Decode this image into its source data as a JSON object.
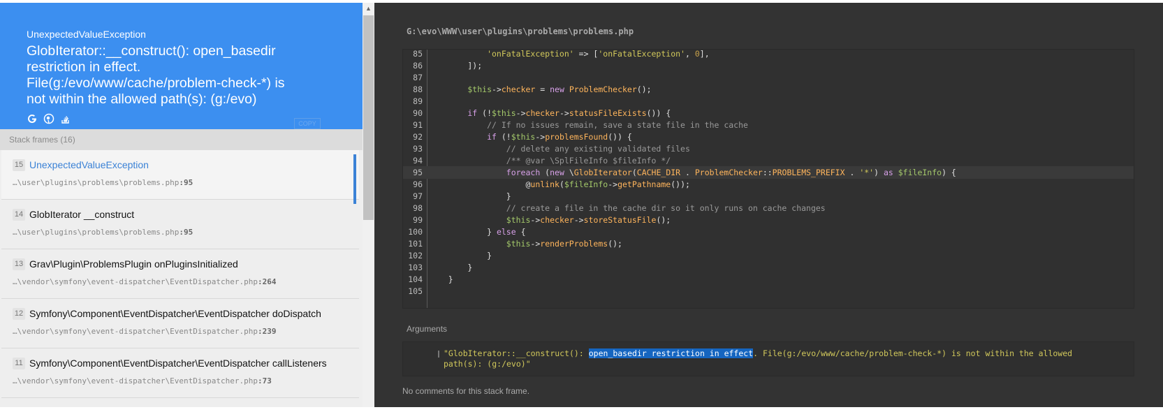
{
  "exception": {
    "type": "UnexpectedValueException",
    "message": "GlobIterator::__construct(): open_basedir restriction in effect. File(g:/evo/www/cache/problem-check-*) is not within the allowed path(s): (g:/evo)",
    "copy_label": "COPY",
    "icons": [
      "google-icon",
      "duckduckgo-icon",
      "stackoverflow-icon"
    ]
  },
  "stack": {
    "title": "Stack frames (16)",
    "frames": [
      {
        "num": "15",
        "class": "UnexpectedValueException",
        "path": "…\\user\\plugins\\problems\\problems.php",
        "line": ":95"
      },
      {
        "num": "14",
        "class": "GlobIterator __construct",
        "path": "…\\user\\plugins\\problems\\problems.php",
        "line": ":95"
      },
      {
        "num": "13",
        "class": "Grav\\Plugin\\ProblemsPlugin onPluginsInitialized",
        "path": "…\\vendor\\symfony\\event-dispatcher\\EventDispatcher.php",
        "line": ":264"
      },
      {
        "num": "12",
        "class": "Symfony\\Component\\EventDispatcher\\EventDispatcher doDispatch",
        "path": "…\\vendor\\symfony\\event-dispatcher\\EventDispatcher.php",
        "line": ":239"
      },
      {
        "num": "11",
        "class": "Symfony\\Component\\EventDispatcher\\EventDispatcher callListeners",
        "path": "…\\vendor\\symfony\\event-dispatcher\\EventDispatcher.php",
        "line": ":73"
      }
    ]
  },
  "code": {
    "file": "G:\\evo\\WWW\\user\\plugins\\problems\\problems.php",
    "highlight_line": 95,
    "lines": [
      {
        "n": 85,
        "segs": [
          [
            "s",
            "            'onFatalException'"
          ],
          [
            "o",
            " => ["
          ],
          [
            "s",
            "'onFatalException'"
          ],
          [
            "o",
            ", "
          ],
          [
            "m",
            "0"
          ],
          [
            "o",
            "],"
          ]
        ]
      },
      {
        "n": 86,
        "segs": [
          [
            "o",
            "        ]);"
          ]
        ]
      },
      {
        "n": 87,
        "segs": []
      },
      {
        "n": 88,
        "segs": [
          [
            "v",
            "        $this"
          ],
          [
            "o",
            "->"
          ],
          [
            "f",
            "checker"
          ],
          [
            "o",
            " = "
          ],
          [
            "k",
            "new"
          ],
          [
            "o",
            " "
          ],
          [
            "f",
            "ProblemChecker"
          ],
          [
            "o",
            "();"
          ]
        ]
      },
      {
        "n": 89,
        "segs": []
      },
      {
        "n": 90,
        "segs": [
          [
            "k",
            "        if"
          ],
          [
            "o",
            " (!"
          ],
          [
            "v",
            "$this"
          ],
          [
            "o",
            "->"
          ],
          [
            "f",
            "checker"
          ],
          [
            "o",
            "->"
          ],
          [
            "f",
            "statusFileExists"
          ],
          [
            "o",
            "()) {"
          ]
        ]
      },
      {
        "n": 91,
        "segs": [
          [
            "c",
            "            // If no issues remain, save a state file in the cache"
          ]
        ]
      },
      {
        "n": 92,
        "segs": [
          [
            "k",
            "            if"
          ],
          [
            "o",
            " (!"
          ],
          [
            "v",
            "$this"
          ],
          [
            "o",
            "->"
          ],
          [
            "f",
            "problemsFound"
          ],
          [
            "o",
            "()) {"
          ]
        ]
      },
      {
        "n": 93,
        "segs": [
          [
            "c",
            "                // delete any existing validated files"
          ]
        ]
      },
      {
        "n": 94,
        "segs": [
          [
            "c",
            "                /** @var \\SplFileInfo $fileInfo */"
          ]
        ]
      },
      {
        "n": 95,
        "segs": [
          [
            "k",
            "                foreach"
          ],
          [
            "o",
            " ("
          ],
          [
            "k",
            "new"
          ],
          [
            "o",
            " \\"
          ],
          [
            "f",
            "GlobIterator"
          ],
          [
            "o",
            "("
          ],
          [
            "f",
            "CACHE_DIR"
          ],
          [
            "o",
            " . "
          ],
          [
            "f",
            "ProblemChecker"
          ],
          [
            "o",
            "::"
          ],
          [
            "f",
            "PROBLEMS_PREFIX"
          ],
          [
            "o",
            " . "
          ],
          [
            "s",
            "'*'"
          ],
          [
            "o",
            ") "
          ],
          [
            "k",
            "as"
          ],
          [
            "o",
            " "
          ],
          [
            "v",
            "$fileInfo"
          ],
          [
            "o",
            ") {"
          ]
        ]
      },
      {
        "n": 96,
        "segs": [
          [
            "o",
            "                    @"
          ],
          [
            "f",
            "unlink"
          ],
          [
            "o",
            "("
          ],
          [
            "v",
            "$fileInfo"
          ],
          [
            "o",
            "->"
          ],
          [
            "f",
            "getPathname"
          ],
          [
            "o",
            "());"
          ]
        ]
      },
      {
        "n": 97,
        "segs": [
          [
            "o",
            "                }"
          ]
        ]
      },
      {
        "n": 98,
        "segs": [
          [
            "c",
            "                // create a file in the cache dir so it only runs on cache changes"
          ]
        ]
      },
      {
        "n": 99,
        "segs": [
          [
            "v",
            "                $this"
          ],
          [
            "o",
            "->"
          ],
          [
            "f",
            "checker"
          ],
          [
            "o",
            "->"
          ],
          [
            "f",
            "storeStatusFile"
          ],
          [
            "o",
            "();"
          ]
        ]
      },
      {
        "n": 100,
        "segs": [
          [
            "o",
            "            } "
          ],
          [
            "k",
            "else"
          ],
          [
            "o",
            " {"
          ]
        ]
      },
      {
        "n": 101,
        "segs": [
          [
            "v",
            "                $this"
          ],
          [
            "o",
            "->"
          ],
          [
            "f",
            "renderProblems"
          ],
          [
            "o",
            "();"
          ]
        ]
      },
      {
        "n": 102,
        "segs": [
          [
            "o",
            "            }"
          ]
        ]
      },
      {
        "n": 103,
        "segs": [
          [
            "o",
            "        }"
          ]
        ]
      },
      {
        "n": 104,
        "segs": [
          [
            "o",
            "    }"
          ]
        ]
      },
      {
        "n": 105,
        "segs": []
      }
    ]
  },
  "arguments": {
    "title": "Arguments",
    "pre": "\"GlobIterator::__construct(): ",
    "selected": "open_basedir restriction in effect",
    "post": ". File(g:/evo/www/cache/problem-check-*) is not within the allowed path(s): (g:/evo)\""
  },
  "comments": "No comments for this stack frame."
}
